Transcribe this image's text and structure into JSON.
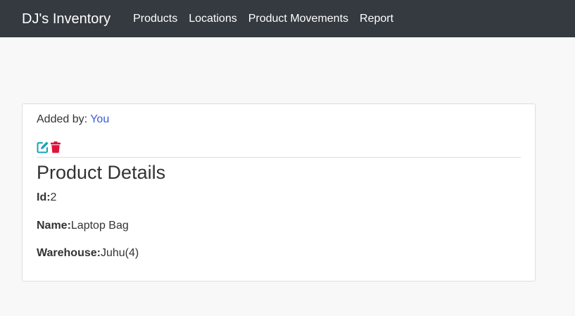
{
  "navbar": {
    "brand": "DJ's Inventory",
    "items": [
      {
        "label": "Products"
      },
      {
        "label": "Locations"
      },
      {
        "label": "Product Movements"
      },
      {
        "label": "Report"
      }
    ]
  },
  "card": {
    "added_by_label": "Added by:",
    "added_by_value": "You",
    "icons": [
      "edit-icon",
      "trash-icon"
    ],
    "title": "Product Details",
    "fields": [
      {
        "label": "Id:",
        "value": "2"
      },
      {
        "label": "Name:",
        "value": "Laptop Bag"
      },
      {
        "label": "Warehouse:",
        "value": "Juhu(4)"
      }
    ]
  },
  "colors": {
    "navbar_bg": "#343a40",
    "page_bg": "#f8f8f8",
    "link": "#3b5bdb",
    "edit_icon": "#17a2b8",
    "trash_icon": "#dc143c"
  }
}
